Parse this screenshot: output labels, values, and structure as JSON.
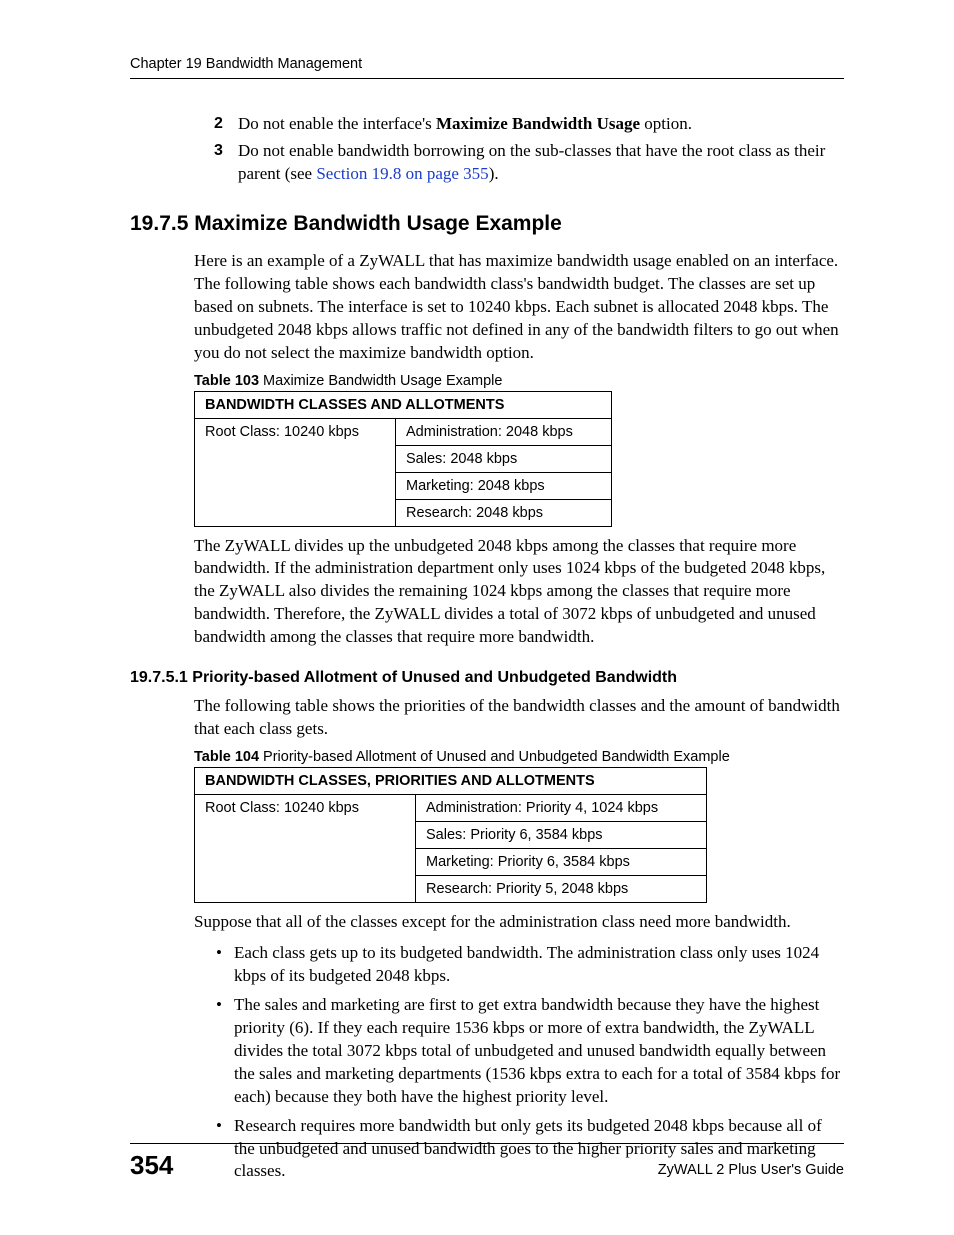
{
  "header": {
    "running": "Chapter 19 Bandwidth Management"
  },
  "steps": {
    "s2": {
      "num": "2",
      "pre": "Do not enable the interface's ",
      "bold": "Maximize Bandwidth Usage",
      "post": " option."
    },
    "s3": {
      "num": "3",
      "pre": "Do not enable bandwidth borrowing on the sub-classes that have the root class as their parent (see ",
      "link": "Section 19.8 on page 355",
      "post": ")."
    }
  },
  "section": {
    "title": "19.7.5  Maximize Bandwidth Usage Example",
    "intro": "Here is an example of a ZyWALL that has maximize bandwidth usage enabled on an interface. The following table shows each bandwidth class's bandwidth budget. The classes are set up based on subnets. The interface is set to 10240 kbps. Each subnet is allocated 2048 kbps. The unbudgeted 2048 kbps allows traffic not defined in any of the bandwidth filters to go out when you do not select the maximize bandwidth option."
  },
  "table103": {
    "cap_bold": "Table 103",
    "cap_rest": "   Maximize Bandwidth Usage Example",
    "header": "BANDWIDTH CLASSES AND ALLOTMENTS",
    "root": "Root Class: 10240 kbps",
    "rows": [
      "Administration: 2048 kbps",
      "Sales: 2048 kbps",
      "Marketing: 2048 kbps",
      "Research: 2048 kbps"
    ]
  },
  "afterTable103": "The ZyWALL divides up the unbudgeted 2048 kbps among the classes that require more bandwidth. If the administration department only uses 1024 kbps of the budgeted 2048 kbps, the ZyWALL also divides the remaining 1024 kbps among the classes that require more bandwidth. Therefore, the ZyWALL divides a total of 3072 kbps of unbudgeted and unused bandwidth among the classes that require more bandwidth.",
  "subsection": {
    "title": "19.7.5.1  Priority-based Allotment of Unused and Unbudgeted Bandwidth",
    "intro": "The following table shows the priorities of the bandwidth classes and the amount of bandwidth that each class gets."
  },
  "table104": {
    "cap_bold": "Table 104",
    "cap_rest": "   Priority-based Allotment of Unused and Unbudgeted Bandwidth Example",
    "header": "BANDWIDTH CLASSES, PRIORITIES AND ALLOTMENTS",
    "root": "Root Class: 10240 kbps",
    "rows": [
      "Administration: Priority 4, 1024 kbps",
      "Sales: Priority 6, 3584 kbps",
      "Marketing: Priority 6, 3584 kbps",
      "Research: Priority 5, 2048 kbps"
    ]
  },
  "afterTable104": "Suppose that all of the classes except for the administration class need more bandwidth.",
  "bullets": [
    "Each class gets up to its budgeted bandwidth. The administration class only uses 1024 kbps of its budgeted 2048 kbps.",
    "The sales and marketing are first to get extra bandwidth because they have the highest priority (6). If they each require 1536 kbps or more of extra bandwidth, the ZyWALL divides the total 3072 kbps total of unbudgeted and unused bandwidth equally between the sales and marketing departments (1536 kbps extra to each for a total of 3584 kbps for each) because they both have the highest priority level.",
    "Research requires more bandwidth but only gets its budgeted 2048 kbps because all of the unbudgeted and unused bandwidth goes to the higher priority sales and marketing classes."
  ],
  "footer": {
    "page": "354",
    "guide": "ZyWALL 2 Plus User's Guide"
  }
}
